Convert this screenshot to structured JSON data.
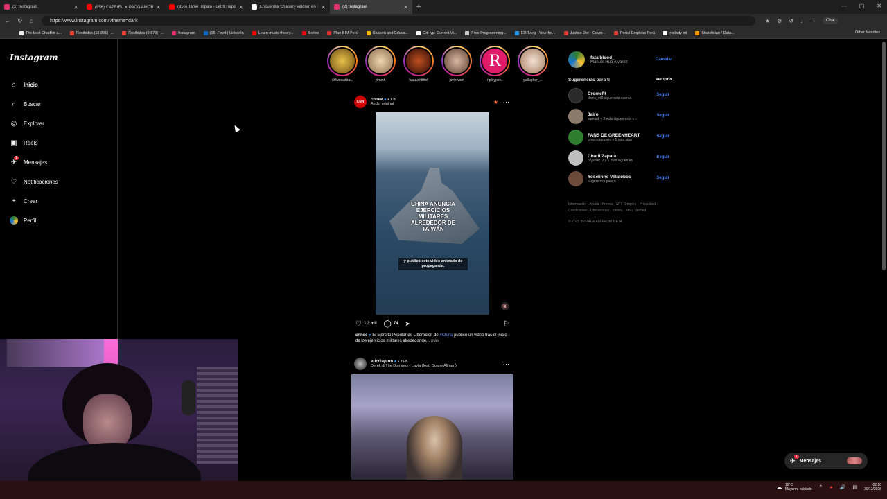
{
  "browser": {
    "tabs": [
      {
        "title": "(2) Instagram",
        "active": false,
        "color": "#e1306c"
      },
      {
        "title": "(956) CA7RIEL ✕ PACO AMOROSO",
        "active": false,
        "color": "#ff0000"
      },
      {
        "title": "(956) Tame Impala - Let It Happen",
        "active": false,
        "color": "#ff0000"
      },
      {
        "title": "Encuentra 'chaturry velorio' en Tik",
        "active": false,
        "color": "#ffffff"
      },
      {
        "title": "(2) Instagram",
        "active": true,
        "color": "#e1306c"
      }
    ],
    "url": "https://www.instagram.com/?theme=dark",
    "chat_label": "Chat",
    "bookmarks": [
      "The best ChatBot a...",
      "Recibidos (15.891) -...",
      "Recibidos (9.879) -...",
      "Instagram",
      "(16) Feed | LinkedIn",
      "Learn music theory...",
      "Series",
      "Plan BIM Perú",
      "Student and Educa...",
      "GitHyp: Current Vi...",
      "Free Programming...",
      "EDIT.org - Your fre...",
      "Justice Der - Cover...",
      "Portal Empleos Perú",
      "melody ml",
      "Statistician / Data..."
    ],
    "other_favorites": "Other favorites"
  },
  "sidebar": {
    "logo": "Instagram",
    "items": [
      {
        "label": "Inicio",
        "icon": "home-icon",
        "glyph": "⌂"
      },
      {
        "label": "Buscar",
        "icon": "search-icon",
        "glyph": "⌕"
      },
      {
        "label": "Explorar",
        "icon": "compass-icon",
        "glyph": "◎"
      },
      {
        "label": "Reels",
        "icon": "reels-icon",
        "glyph": "▣"
      },
      {
        "label": "Mensajes",
        "icon": "messenger-icon",
        "glyph": "✈"
      },
      {
        "label": "Notificaciones",
        "icon": "heart-icon",
        "glyph": "♡"
      },
      {
        "label": "Crear",
        "icon": "plus-icon",
        "glyph": "+"
      },
      {
        "label": "Perfil",
        "icon": "avatar-icon",
        "glyph": "●"
      }
    ],
    "messages_badge": "1"
  },
  "stories": [
    {
      "name": "oblivioustba...",
      "color": "#c9a227"
    },
    {
      "name": "yimeth",
      "color": "#c8a77a"
    },
    {
      "name": "fuuuucktthef",
      "color": "#7a2a12"
    },
    {
      "name": "javiervsm",
      "color": "#b28c78"
    },
    {
      "name": "ripleyperu",
      "color": "#e01b6a",
      "letter": "R"
    },
    {
      "name": "gallagher_...",
      "color": "#d8b7a0"
    }
  ],
  "posts": [
    {
      "user": "cnnee",
      "time": "• 7 h",
      "audio": "Audio original",
      "overlay_title": "CHINA ANUNCIA EJERCICIOS MILITARES ALREDEDOR DE TAIWÁN",
      "subtitle": "y publicó este video animado de propaganda.",
      "likes": "1,3 mil",
      "comments": "74",
      "caption_user": "cnnee",
      "caption_pre": "El Ejército Popular de Liberación de",
      "caption_tag": "#China",
      "caption_post": "publicó un video tras el inicio de los ejercicios militares alrededor de...",
      "caption_more": "más"
    },
    {
      "user": "ericclapton",
      "time": "• 15 h",
      "audio": "Derek & The Dominos • Layla (feat. Duane Allman)"
    }
  ],
  "right": {
    "username": "fatalblood_",
    "fullname": "Manuel Rúa Alvarez",
    "switch": "Cambiar",
    "suggestions_title": "Sugerencias para ti",
    "see_all": "Ver todo",
    "follow": "Seguir",
    "suggestions": [
      {
        "name": "Cromefit",
        "sub": "denis_vc9 sigue esta cuenta",
        "color": "#2a2a2a"
      },
      {
        "name": "Jairo",
        "sub": "samiadj y 2 más siguen esta c",
        "color": "#8a7a6a"
      },
      {
        "name": "FANS DE GREENHEART",
        "sub": "greenheartperu y 1 más sigu",
        "color": "#2f7d2f"
      },
      {
        "name": "Charli Zapata",
        "sub": "bryanlet12 y 1 más siguen es",
        "color": "#bdbdbd"
      },
      {
        "name": "Yoselinne Villalobos",
        "sub": "Sugerencia para ti",
        "color": "#6b4a3a"
      }
    ],
    "footer": "Información · Ayuda · Prensa · API · Empleo · Privacidad · Condiciones · Ubicaciones · Idioma · Meta Verified",
    "copyright": "© 2025 INSTAGRAM FROM META"
  },
  "messages_pill": "Mensajes",
  "taskbar": {
    "temp": "19°C",
    "weather": "Mayorm. nublado",
    "time": "02:10",
    "date": "30/12/2025"
  }
}
